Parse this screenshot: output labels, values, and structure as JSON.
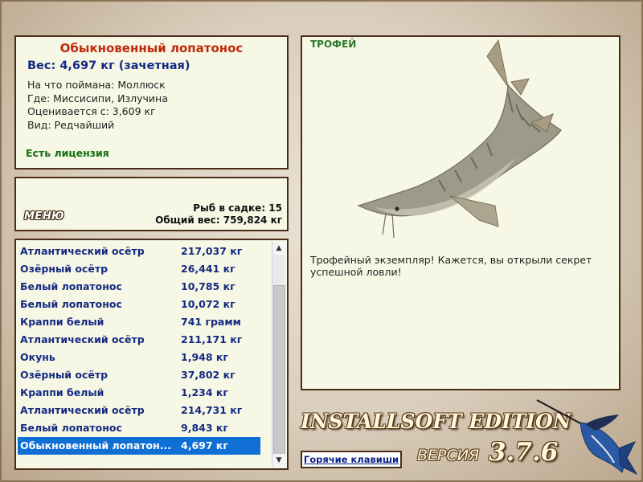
{
  "info": {
    "title": "Обыкновенный лопатонос",
    "weight": "Вес: 4,697 кг (зачетная)",
    "caught_on": "На что поймана: Моллюск",
    "location": "Где: Миссисипи, Излучина",
    "valued_from": "Оценивается с: 3,609 кг",
    "kind": "Вид: Редчайший",
    "license": "Есть лицензия"
  },
  "summary": {
    "menu_label": "МЕНЮ",
    "fish_count": "Рыб в садке: 15",
    "total_weight": "Общий вес: 759,824 кг"
  },
  "catch_list": [
    {
      "name": "Атлантический осётр",
      "weight": "217,037 кг"
    },
    {
      "name": "Озёрный осётр",
      "weight": "26,441 кг"
    },
    {
      "name": "Белый лопатонос",
      "weight": "10,785 кг"
    },
    {
      "name": "Белый лопатонос",
      "weight": "10,072 кг"
    },
    {
      "name": "Краппи белый",
      "weight": "741 грамм"
    },
    {
      "name": "Атлантический осётр",
      "weight": "211,171 кг"
    },
    {
      "name": "Окунь",
      "weight": "1,948 кг"
    },
    {
      "name": "Озёрный осётр",
      "weight": "37,802 кг"
    },
    {
      "name": "Краппи белый",
      "weight": "1,234 кг"
    },
    {
      "name": "Атлантический осётр",
      "weight": "214,731 кг"
    },
    {
      "name": "Белый лопатонос",
      "weight": "9,843 кг"
    },
    {
      "name": "Обыкновенный лопатон...",
      "weight": "4,697 кг"
    }
  ],
  "selected_index": 11,
  "trophy": {
    "tag": "ТРОФЕЙ",
    "description": "Трофейный экземпляр! Кажется, вы открыли секрет успешной ловли!"
  },
  "footer": {
    "hotkeys_label": "Горячие клавиши",
    "edition": "INSTALLSOFT EDITION",
    "version_label": "ВЕРСИЯ",
    "version_number": "3.7.6"
  },
  "icons": {
    "trophy_fish": "sturgeon-icon",
    "logo": "marlin-icon",
    "scroll_up": "arrow-up-icon",
    "scroll_down": "arrow-down-icon"
  },
  "colors": {
    "title": "#c02a0a",
    "list_text": "#142a82",
    "selected_row": "#0f6fd4",
    "license": "#127012"
  }
}
